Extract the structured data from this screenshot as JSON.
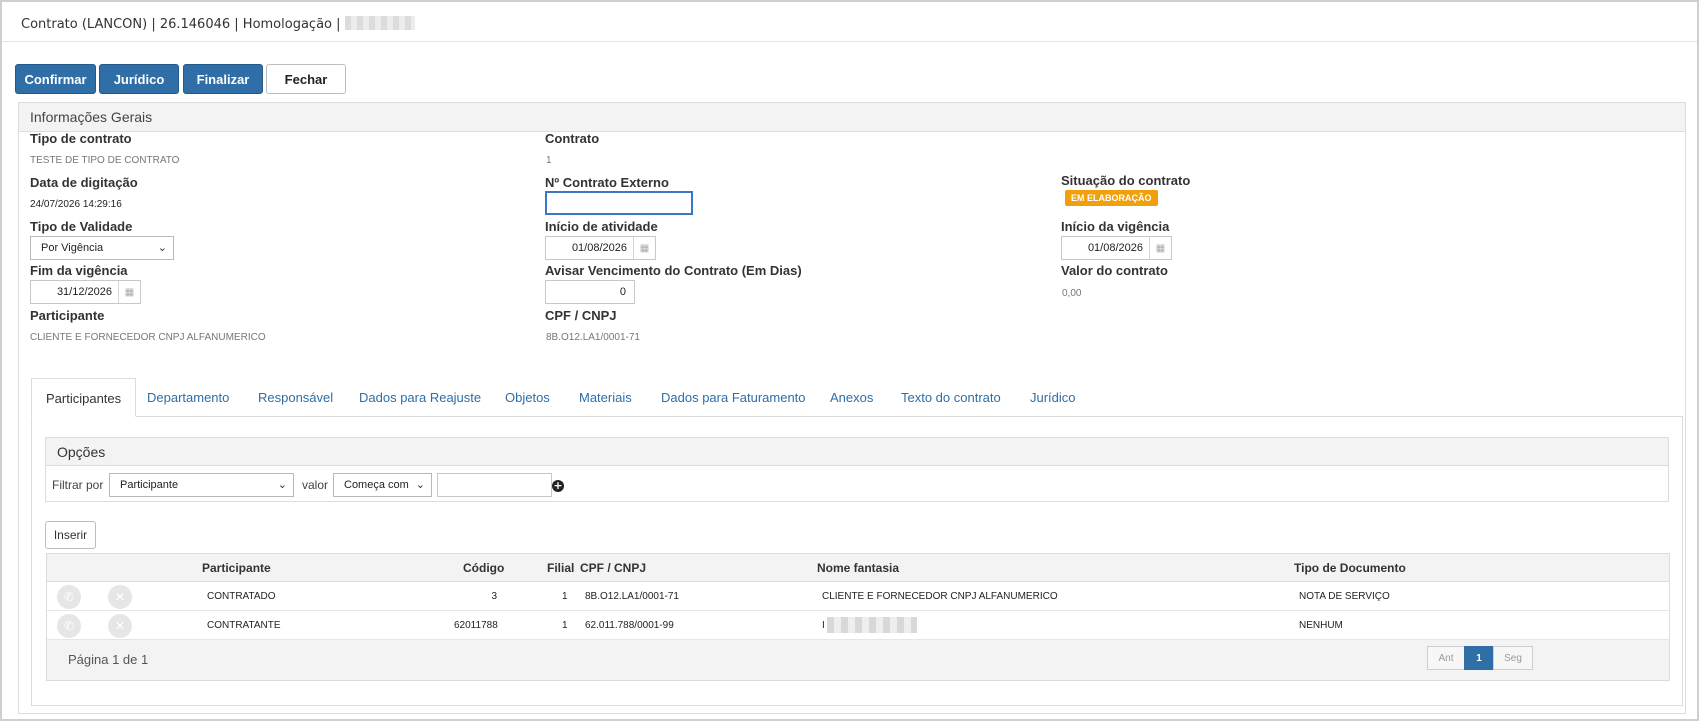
{
  "window": {
    "title": "Contrato (LANCON) | 26.146046 | Homologação |"
  },
  "toolbar": {
    "confirmar": "Confirmar",
    "juridico": "Jurídico",
    "finalizar": "Finalizar",
    "fechar": "Fechar"
  },
  "info": {
    "section_title": "Informações Gerais",
    "tipo_contrato_label": "Tipo de contrato",
    "tipo_contrato_value": "TESTE DE TIPO DE CONTRATO",
    "contrato_label": "Contrato",
    "contrato_value": "1",
    "data_digitacao_label": "Data de digitação",
    "data_digitacao_value": "24/07/2026 14:29:16",
    "contrato_externo_label": "Nº Contrato Externo",
    "contrato_externo_value": "",
    "situacao_label": "Situação do contrato",
    "situacao_value": "EM ELABORAÇÃO",
    "tipo_validade_label": "Tipo de Validade",
    "tipo_validade_value": "Por Vigência",
    "inicio_atividade_label": "Início de atividade",
    "inicio_atividade_value": "01/08/2026",
    "inicio_vigencia_label": "Início da vigência",
    "inicio_vigencia_value": "01/08/2026",
    "fim_vigencia_label": "Fim da vigência",
    "fim_vigencia_value": "31/12/2026",
    "avisar_label": "Avisar Vencimento do Contrato (Em Dias)",
    "avisar_value": "0",
    "valor_label": "Valor do contrato",
    "valor_value": "0,00",
    "participante_label": "Participante",
    "participante_value": "CLIENTE E FORNECEDOR CNPJ ALFANUMERICO",
    "cpf_label": "CPF / CNPJ",
    "cpf_value": "8B.O12.LA1/0001-71"
  },
  "tabs": [
    {
      "label": "Participantes"
    },
    {
      "label": "Departamento"
    },
    {
      "label": "Responsável"
    },
    {
      "label": "Dados para Reajuste"
    },
    {
      "label": "Objetos"
    },
    {
      "label": "Materiais"
    },
    {
      "label": "Dados para Faturamento"
    },
    {
      "label": "Anexos"
    },
    {
      "label": "Texto do contrato"
    },
    {
      "label": "Jurídico"
    }
  ],
  "opcoes": {
    "title": "Opções",
    "filtrar_label": "Filtrar por",
    "filtrar_value": "Participante",
    "valor_label": "valor",
    "condicao_value": "Começa com",
    "search_value": ""
  },
  "inserir": "Inserir",
  "grid": {
    "headers": {
      "participante": "Participante",
      "codigo": "Código",
      "filial": "Filial",
      "cpf": "CPF / CNPJ",
      "nome": "Nome fantasia",
      "tipo": "Tipo de Documento"
    },
    "rows": [
      {
        "participante": "CONTRATADO",
        "codigo": "3",
        "filial": "1",
        "cpf": "8B.O12.LA1/0001-71",
        "nome": "CLIENTE E FORNECEDOR CNPJ ALFANUMERICO",
        "tipo": "NOTA DE SERVIÇO"
      },
      {
        "participante": "CONTRATANTE",
        "codigo": "62011788",
        "filial": "1",
        "cpf": "62.011.788/0001-99",
        "nome": "I",
        "tipo": "NENHUM"
      }
    ],
    "pagination": "Página 1 de 1",
    "pager": {
      "prev": "Ant",
      "current": "1",
      "next": "Seg"
    }
  }
}
